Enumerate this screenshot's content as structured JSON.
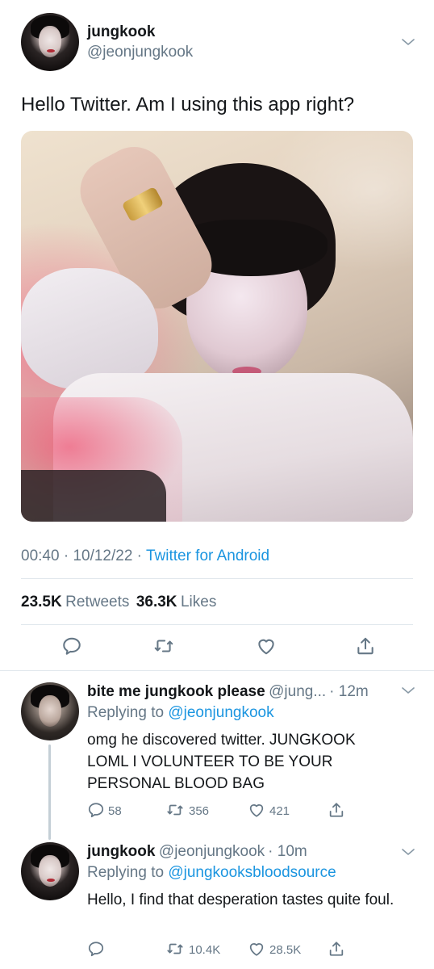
{
  "main_tweet": {
    "display_name": "jungkook",
    "handle": "@jeonjungkook",
    "text": "Hello Twitter. Am I using this app right?",
    "time": "00:40",
    "date": "10/12/22",
    "source": "Twitter for Android",
    "retweets_count": "23.5K",
    "retweets_label": "Retweets",
    "likes_count": "36.3K",
    "likes_label": "Likes"
  },
  "replies": [
    {
      "display_name": "bite me jungkook please",
      "handle": "@jung...",
      "time": "· 12m",
      "replying_to_label": "Replying to",
      "replying_to_handle": "@jeonjungkook",
      "text": "omg he discovered twitter. JUNGKOOK LOML I VOLUNTEER TO BE YOUR PERSONAL BLOOD BAG",
      "reply_count": "58",
      "retweet_count": "356",
      "like_count": "421"
    },
    {
      "display_name": "jungkook",
      "handle": "@jeonjungkook",
      "time": "· 10m",
      "replying_to_label": "Replying to",
      "replying_to_handle": "@jungkooksbloodsource",
      "text": "Hello, I find that desperation tastes quite foul.",
      "reply_count": "",
      "retweet_count": "10.4K",
      "like_count": "28.5K"
    }
  ],
  "icons": {
    "reply": "reply-icon",
    "retweet": "retweet-icon",
    "like": "heart-icon",
    "share": "share-icon",
    "more": "chevron-down-icon"
  },
  "colors": {
    "link": "#1b95e0",
    "secondary_text": "#657786",
    "primary_text": "#14171a",
    "divider": "#e1e8ed"
  }
}
